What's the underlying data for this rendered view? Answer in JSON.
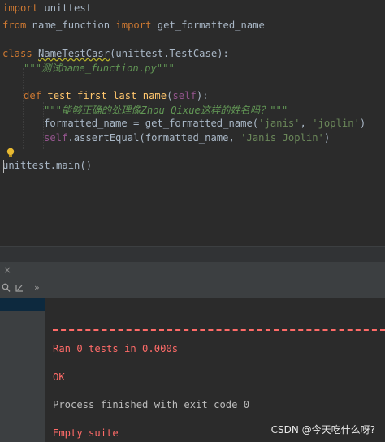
{
  "code": {
    "l1": {
      "kw": "import",
      "rest": " unittest"
    },
    "l2": {
      "kw1": "from",
      "mod": " name_function ",
      "kw2": "import",
      "rest": " get_formatted_name"
    },
    "l4": {
      "kw": "class",
      "sp": " ",
      "name": "NameTestCasr",
      "rest": "(unittest.TestCase):"
    },
    "l5": {
      "doc": "\"\"\"测试name_function.py\"\"\""
    },
    "l7": {
      "kw": "def",
      "sp": " ",
      "name": "test_first_last_name",
      "p1": "(",
      "self": "self",
      "p2": "):"
    },
    "l8": {
      "doc": "\"\"\"能够正确的处理像Zhou Qixue这样的姓名吗？\"\"\""
    },
    "l9": {
      "a": "formatted_name = get_formatted_name(",
      "s1": "'janis'",
      "c": ", ",
      "s2": "'joplin'",
      "e": ")"
    },
    "l10": {
      "self": "self",
      "a": ".assertEqual(formatted_name, ",
      "s": "'Janis Joplin'",
      "e": ")"
    },
    "l12": {
      "text": "unittest.main()"
    }
  },
  "runbar": {
    "close": "×"
  },
  "toolbar": {
    "chevron": "»"
  },
  "console": {
    "ran": "Ran 0 tests in 0.000s",
    "ok": "OK",
    "finished": "Process finished with exit code 0",
    "empty": "Empty suite"
  },
  "watermark": "CSDN @今天吃什么呀?",
  "colors": {
    "background": "#2b2b2b",
    "keyword": "#cc7832",
    "string": "#6a8759",
    "function": "#ffc66d",
    "error": "#ff6b68"
  }
}
